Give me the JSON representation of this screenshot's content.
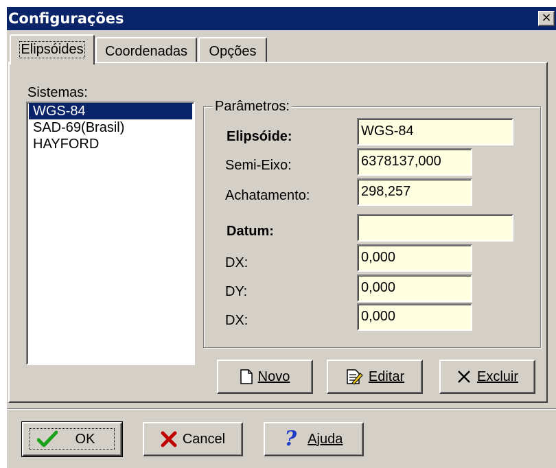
{
  "window": {
    "title": "Configurações",
    "close_glyph": "×"
  },
  "tabs": [
    {
      "label": "Elipsóides",
      "active": true
    },
    {
      "label": "Coordenadas",
      "active": false
    },
    {
      "label": "Opções",
      "active": false
    }
  ],
  "sistemas": {
    "label": "Sistemas:",
    "items": [
      "WGS-84",
      "SAD-69(Brasil)",
      "HAYFORD"
    ],
    "selected_index": 0
  },
  "parametros": {
    "title": "Parâmetros:",
    "elipsoide_label": "Elipsóide:",
    "elipsoide_value": "WGS-84",
    "semi_eixo_label": "Semi-Eixo:",
    "semi_eixo_value": "6378137,000",
    "achatamento_label": "Achatamento:",
    "achatamento_value": "298,257",
    "datum_label": "Datum:",
    "datum_value": "",
    "dx_label": "DX:",
    "dx_value": "0,000",
    "dy_label": "DY:",
    "dy_value": "0,000",
    "dz_label": "DX:",
    "dz_value": "0,000"
  },
  "actions": {
    "novo_label": "Novo",
    "editar_label": "Editar",
    "excluir_label": "Excluir"
  },
  "footer": {
    "ok_label": "OK",
    "cancel_label": "Cancel",
    "ajuda_label": "Ajuda"
  },
  "colors": {
    "titlebar": "#0a246a",
    "face": "#d4d0c8",
    "field_bg": "#ffffe1",
    "ok_check": "#1aa01a",
    "cancel_x": "#c00000",
    "help_q": "#1e3cc8"
  },
  "icons": {
    "novo": "document-icon",
    "editar": "edit-document-icon",
    "excluir": "x-icon",
    "ok": "checkmark-icon",
    "cancel": "red-x-icon",
    "ajuda": "question-mark-icon"
  }
}
